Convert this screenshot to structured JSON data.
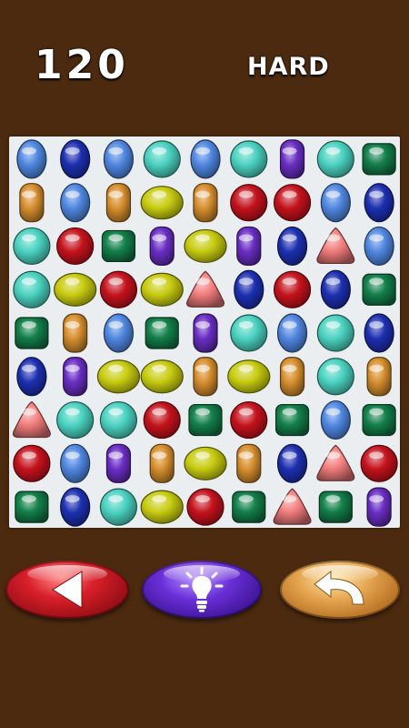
{
  "header": {
    "score": "120",
    "difficulty": "HARD"
  },
  "board": {
    "rows": 9,
    "cols": 9,
    "background": "#ebeef1",
    "gems": [
      [
        "blue-egg",
        "navy-egg",
        "blue-egg",
        "teal-round",
        "blue-egg",
        "teal-round",
        "purple-pill",
        "teal-round",
        "green-square"
      ],
      [
        "amber-pill",
        "blue-egg",
        "amber-pill",
        "yellow-oval",
        "amber-pill",
        "red-round",
        "red-round",
        "blue-egg",
        "navy-egg"
      ],
      [
        "teal-round",
        "red-round",
        "green-square",
        "purple-pill",
        "yellow-oval",
        "purple-pill",
        "navy-egg",
        "pink-triangle",
        "blue-egg"
      ],
      [
        "teal-round",
        "yellow-oval",
        "red-round",
        "yellow-oval",
        "pink-triangle",
        "navy-egg",
        "red-round",
        "navy-egg",
        "green-square"
      ],
      [
        "green-square",
        "amber-pill",
        "blue-egg",
        "green-square",
        "purple-pill",
        "teal-round",
        "blue-egg",
        "teal-round",
        "navy-egg"
      ],
      [
        "navy-egg",
        "purple-pill",
        "yellow-oval",
        "yellow-oval",
        "amber-pill",
        "yellow-oval",
        "amber-pill",
        "teal-round",
        "amber-pill"
      ],
      [
        "pink-triangle",
        "teal-round",
        "teal-round",
        "red-round",
        "green-square",
        "red-round",
        "green-square",
        "blue-egg",
        "green-square"
      ],
      [
        "red-round",
        "blue-egg",
        "purple-pill",
        "amber-pill",
        "yellow-oval",
        "amber-pill",
        "navy-egg",
        "pink-triangle",
        "red-round"
      ],
      [
        "green-square",
        "navy-egg",
        "teal-round",
        "yellow-oval",
        "red-round",
        "green-square",
        "pink-triangle",
        "green-square",
        "purple-pill"
      ]
    ]
  },
  "colors": {
    "background": "#4b2a0f",
    "blue": "#4f86e0",
    "navy": "#1c2fb0",
    "teal": "#4ad2c0",
    "purple": "#6a2ec4",
    "green": "#13804a",
    "amber": "#d88f2e",
    "yellow": "#c8cc10",
    "red": "#c4121c",
    "pink": "#f27c7c"
  },
  "controls": {
    "back": {
      "icon": "back-arrow-icon",
      "color": "#c4121c"
    },
    "hint": {
      "icon": "lightbulb-icon",
      "color": "#5a22c8"
    },
    "undo": {
      "icon": "undo-arrow-icon",
      "color": "#d88f2e"
    }
  }
}
